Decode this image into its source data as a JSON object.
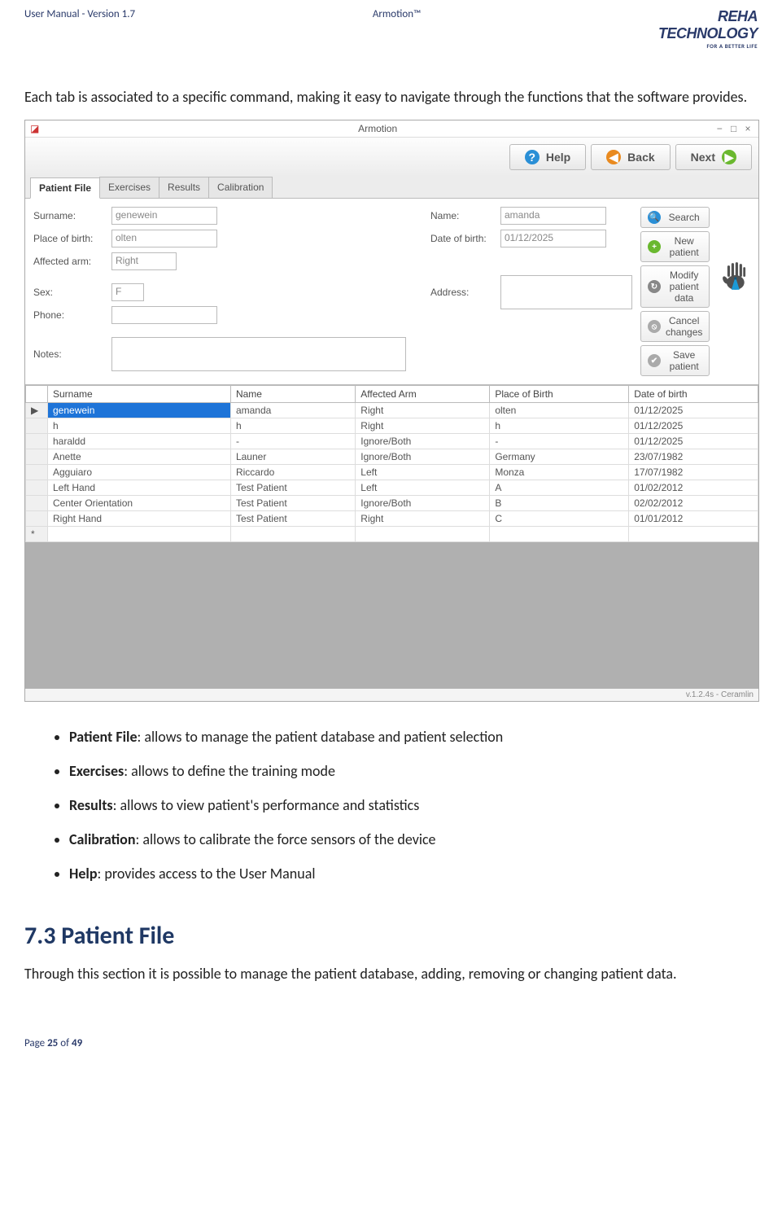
{
  "doc_header": {
    "left": "User Manual - Version 1.7",
    "center": "Armotion™",
    "logo_line1a": "REHA",
    "logo_line1b": "TECHNOLOGY",
    "logo_line2": "FOR A BETTER LIFE"
  },
  "intro_paragraph": "Each tab is associated to a specific command, making it easy to navigate through the functions that the software provides.",
  "screenshot": {
    "title": "Armotion",
    "toolbar": {
      "help": "Help",
      "back": "Back",
      "next": "Next"
    },
    "tabs": [
      "Patient File",
      "Exercises",
      "Results",
      "Calibration"
    ],
    "form": {
      "surname_label": "Surname:",
      "surname_value": "genewein",
      "place_label": "Place of birth:",
      "place_value": "olten",
      "affected_label": "Affected arm:",
      "affected_value": "Right",
      "sex_label": "Sex:",
      "sex_value": "F",
      "phone_label": "Phone:",
      "phone_value": "",
      "notes_label": "Notes:",
      "name_label": "Name:",
      "name_value": "amanda",
      "dob_label": "Date of birth:",
      "dob_value": "01/12/2025",
      "address_label": "Address:"
    },
    "side_buttons": {
      "search": "Search",
      "new_patient": "New patient",
      "modify": "Modify patient data",
      "cancel": "Cancel changes",
      "save": "Save patient"
    },
    "columns": [
      "Surname",
      "Name",
      "Affected Arm",
      "Place of Birth",
      "Date of birth"
    ],
    "rows": [
      {
        "surname": "genewein",
        "name": "amanda",
        "arm": "Right",
        "place": "olten",
        "dob": "01/12/2025",
        "selected": true
      },
      {
        "surname": "h",
        "name": "h",
        "arm": "Right",
        "place": "h",
        "dob": "01/12/2025"
      },
      {
        "surname": "haraldd",
        "name": "-",
        "arm": "Ignore/Both",
        "place": "-",
        "dob": "01/12/2025"
      },
      {
        "surname": "Anette",
        "name": "Launer",
        "arm": "Ignore/Both",
        "place": "Germany",
        "dob": "23/07/1982"
      },
      {
        "surname": "Agguiaro",
        "name": "Riccardo",
        "arm": "Left",
        "place": "Monza",
        "dob": "17/07/1982"
      },
      {
        "surname": "Left Hand",
        "name": "Test Patient",
        "arm": "Left",
        "place": "A",
        "dob": "01/02/2012"
      },
      {
        "surname": "Center Orientation",
        "name": "Test Patient",
        "arm": "Ignore/Both",
        "place": "B",
        "dob": "02/02/2012"
      },
      {
        "surname": "Right Hand",
        "name": "Test Patient",
        "arm": "Right",
        "place": "C",
        "dob": "01/01/2012"
      }
    ],
    "version_tag": "v.1.2.4s - Ceramlin"
  },
  "bullets": [
    {
      "label": "Patient File",
      "text": ": allows to manage the patient database and patient selection"
    },
    {
      "label": "Exercises",
      "text": ": allows to define the training mode"
    },
    {
      "label": "Results",
      "text": ": allows to view patient's performance and statistics"
    },
    {
      "label": "Calibration",
      "text": ": allows to calibrate the force sensors of the  device"
    },
    {
      "label": "Help",
      "text": ": provides access to the User Manual"
    }
  ],
  "section_heading": "7.3 Patient File",
  "section_text": "Through this section it is possible to manage the patient database, adding, removing or changing patient data.",
  "footer": {
    "prefix": "Page ",
    "page": "25",
    "middle": " of ",
    "total": "49"
  }
}
